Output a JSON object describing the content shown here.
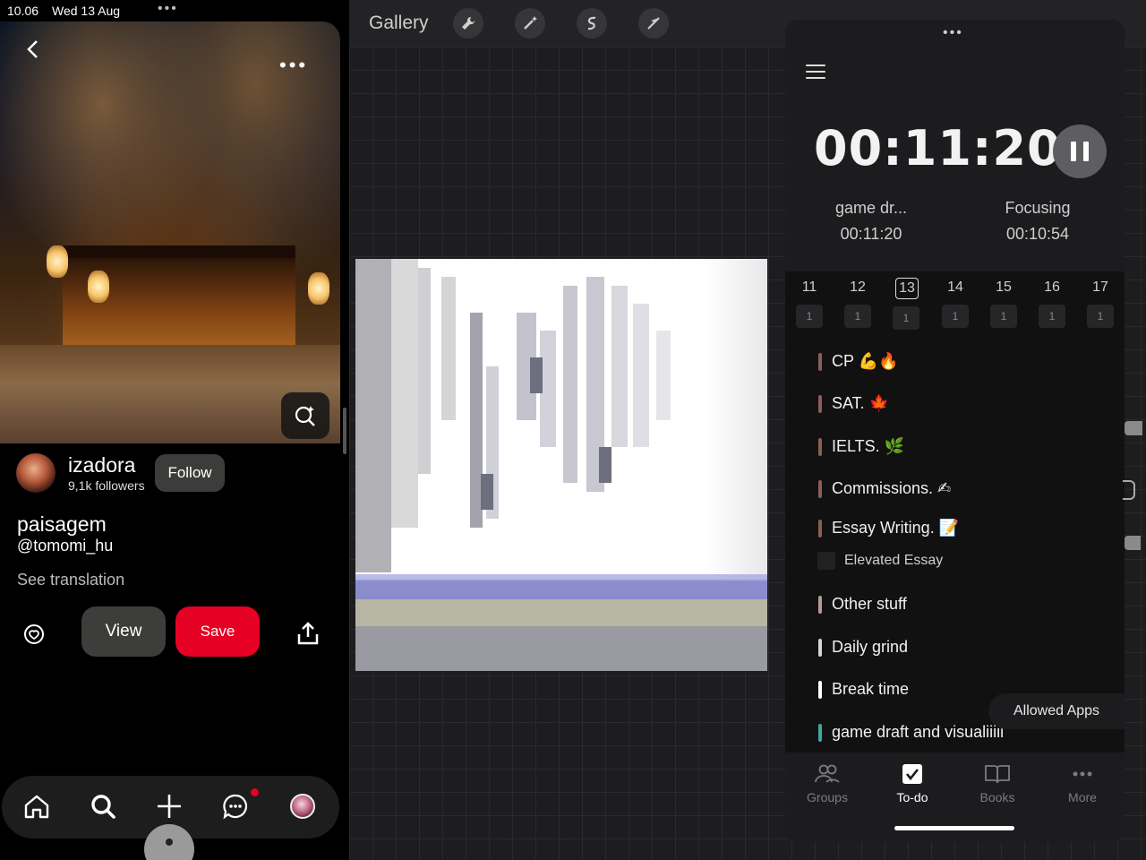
{
  "status": {
    "time": "10.06",
    "date": "Wed 13 Aug",
    "dots": "•••"
  },
  "pinterest": {
    "more": "•••",
    "user": {
      "name": "izadora",
      "followers": "9,1k followers",
      "follow_label": "Follow"
    },
    "pin": {
      "title": "paisagem",
      "handle": "@tomomi_hu",
      "see_translation": "See translation"
    },
    "actions": {
      "view_label": "View",
      "save_label": "Save"
    }
  },
  "procreate": {
    "gallery_label": "Gallery",
    "tools": [
      "wrench-icon",
      "magic-wand-icon",
      "selection-icon",
      "transform-arrow-icon"
    ]
  },
  "timer": {
    "dots": "•••",
    "clock": "00:11:20",
    "current": {
      "name": "game dr...",
      "time": "00:11:20"
    },
    "mode": {
      "name": "Focusing",
      "time": "00:10:54"
    },
    "week": [
      {
        "num": "11",
        "count": "1",
        "selected": false
      },
      {
        "num": "12",
        "count": "1",
        "selected": false
      },
      {
        "num": "13",
        "count": "1",
        "selected": true
      },
      {
        "num": "14",
        "count": "1",
        "selected": false
      },
      {
        "num": "15",
        "count": "1",
        "selected": false
      },
      {
        "num": "16",
        "count": "1",
        "selected": false
      },
      {
        "num": "17",
        "count": "1",
        "selected": false
      }
    ],
    "tasks": [
      {
        "label": "CP 💪🔥",
        "color": "#8b5e55"
      },
      {
        "label": "SAT. 🍁",
        "color": "#8b5e55"
      },
      {
        "label": "IELTS. 🌿",
        "color": "#8b5e55"
      },
      {
        "label": "Commissions. ✍",
        "color": "#8b5e55"
      },
      {
        "label": "Essay Writing. 📝",
        "color": "#8b5e55"
      },
      {
        "label": "Other stuff",
        "color": "#b69a96"
      },
      {
        "label": "Daily grind",
        "color": "#d9d4d2"
      },
      {
        "label": "Break time",
        "color": "#ffffff"
      },
      {
        "label": "game draft and visualiiiii",
        "color": "#3fa8a0"
      }
    ],
    "subtask": "Elevated Essay",
    "allowed_apps": "Allowed Apps",
    "tabs": [
      {
        "label": "Groups",
        "icon": "groups-icon",
        "active": false
      },
      {
        "label": "To-do",
        "icon": "todo-check-icon",
        "active": true
      },
      {
        "label": "Books",
        "icon": "books-icon",
        "active": false
      },
      {
        "label": "More",
        "icon": "more-dots-icon",
        "active": false
      }
    ]
  }
}
